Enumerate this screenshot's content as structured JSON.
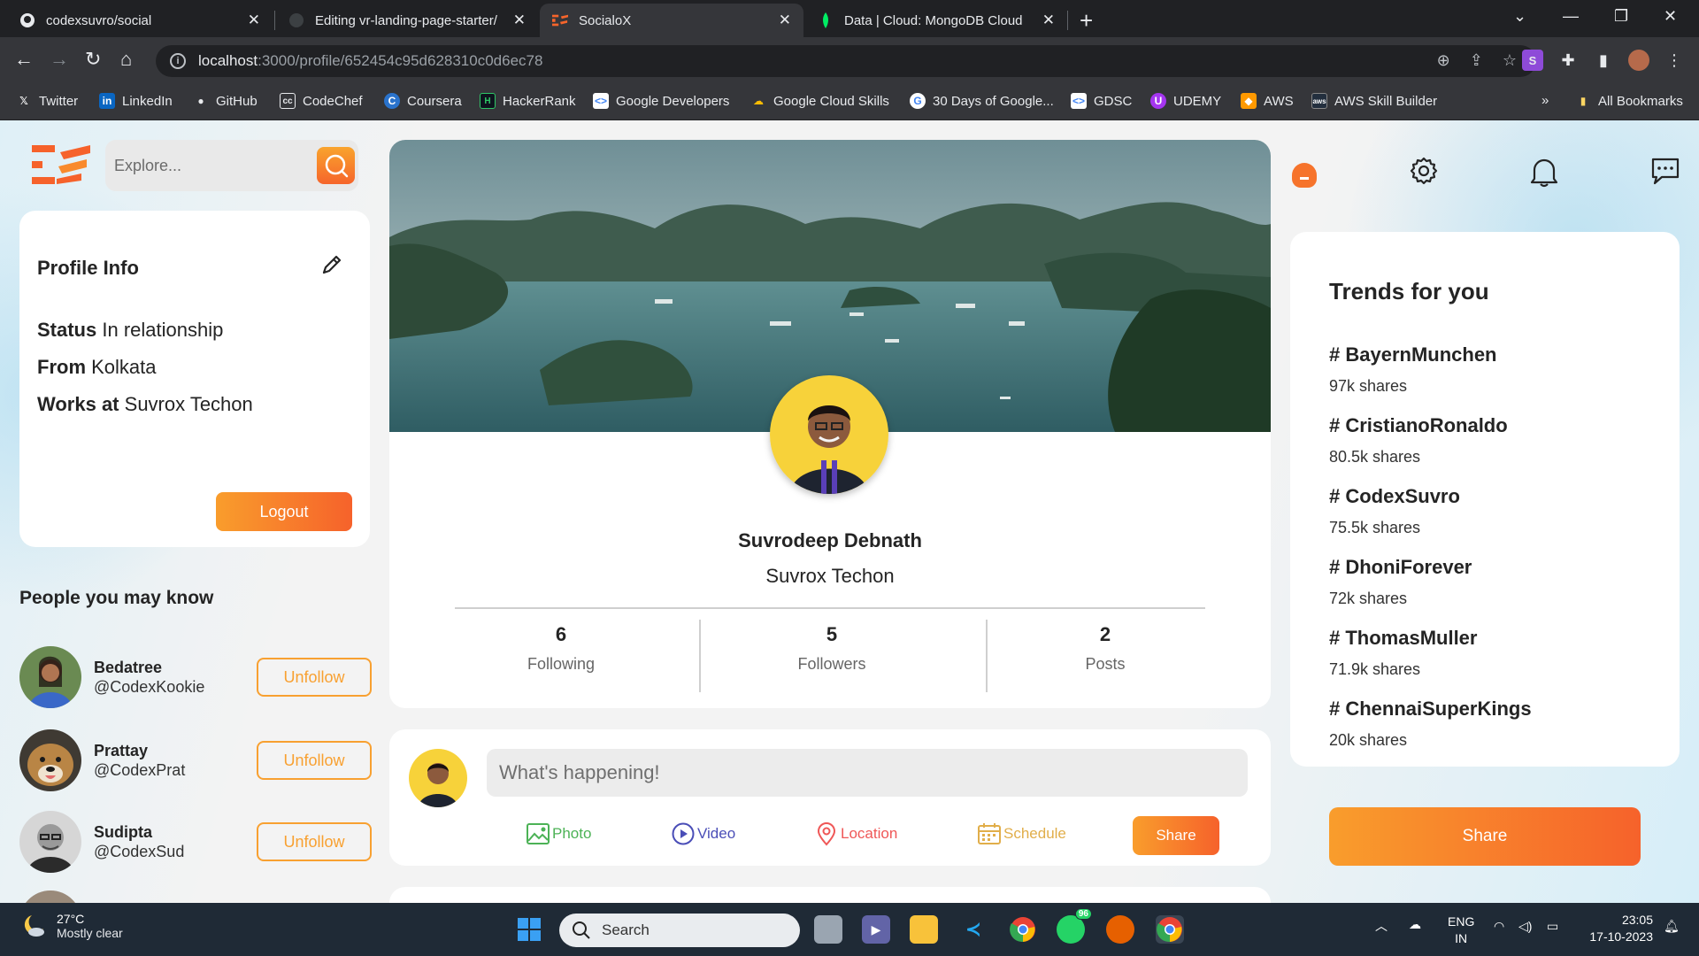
{
  "browser": {
    "tabs": [
      {
        "title": "codexsuvro/social",
        "active": false
      },
      {
        "title": "Editing vr-landing-page-starter/",
        "active": false
      },
      {
        "title": "SocialoX",
        "active": true
      },
      {
        "title": "Data | Cloud: MongoDB Cloud",
        "active": false
      }
    ],
    "url_host": "localhost",
    "url_path": ":3000/profile/652454c95d628310c0d6ec78",
    "bookmarks": [
      {
        "label": "Twitter",
        "icon": "x-icon"
      },
      {
        "label": "LinkedIn",
        "icon": "linkedin-icon"
      },
      {
        "label": "GitHub",
        "icon": "github-icon"
      },
      {
        "label": "CodeChef",
        "icon": "codechef-icon"
      },
      {
        "label": "Coursera",
        "icon": "coursera-icon"
      },
      {
        "label": "HackerRank",
        "icon": "hackerrank-icon"
      },
      {
        "label": "Google Developers",
        "icon": "google-developers-icon"
      },
      {
        "label": "Google Cloud Skills",
        "icon": "google-cloud-icon"
      },
      {
        "label": "30 Days of Google...",
        "icon": "google-icon"
      },
      {
        "label": "GDSC",
        "icon": "gdsc-icon"
      },
      {
        "label": "UDEMY",
        "icon": "udemy-icon"
      },
      {
        "label": "AWS",
        "icon": "aws-icon"
      },
      {
        "label": "AWS Skill Builder",
        "icon": "aws-icon"
      }
    ],
    "more_bookmarks": "»",
    "all_bookmarks": "All Bookmarks"
  },
  "app": {
    "search_placeholder": "Explore...",
    "profile_info": {
      "title": "Profile Info",
      "status_label": "Status",
      "status_value": "In relationship",
      "from_label": "From",
      "from_value": "Kolkata",
      "works_label": "Works at",
      "works_value": "Suvrox Techon",
      "logout": "Logout"
    },
    "people_title": "People you may know",
    "people": [
      {
        "name": "Bedatree",
        "handle": "@CodexKookie",
        "action": "Unfollow"
      },
      {
        "name": "Prattay",
        "handle": "@CodexPrat",
        "action": "Unfollow"
      },
      {
        "name": "Sudipta",
        "handle": "@CodexSud",
        "action": "Unfollow"
      }
    ],
    "profile": {
      "name": "Suvrodeep Debnath",
      "work": "Suvrox Techon",
      "stats": [
        {
          "value": "6",
          "label": "Following"
        },
        {
          "value": "5",
          "label": "Followers"
        },
        {
          "value": "2",
          "label": "Posts"
        }
      ]
    },
    "post_box": {
      "placeholder": "What's happening!",
      "options": [
        {
          "label": "Photo",
          "color": "#4cb256"
        },
        {
          "label": "Video",
          "color": "#4a4eb7"
        },
        {
          "label": "Location",
          "color": "#ef5757"
        },
        {
          "label": "Schedule",
          "color": "#e1ae4a"
        }
      ],
      "share": "Share"
    },
    "trends_title": "Trends for you",
    "trends": [
      {
        "tag": "# BayernMunchen",
        "shares": "97k shares"
      },
      {
        "tag": "# CristianoRonaldo",
        "shares": "80.5k shares"
      },
      {
        "tag": "# CodexSuvro",
        "shares": "75.5k shares"
      },
      {
        "tag": "# DhoniForever",
        "shares": "72k shares"
      },
      {
        "tag": "# ThomasMuller",
        "shares": "71.9k shares"
      },
      {
        "tag": "# ChennaiSuperKings",
        "shares": "20k shares"
      }
    ],
    "share_big": "Share",
    "accent": "#f99d2c"
  },
  "taskbar": {
    "temp": "27°C",
    "weather": "Mostly clear",
    "search": "Search",
    "whatsapp_badge": "96",
    "lang1": "ENG",
    "lang2": "IN",
    "time": "23:05",
    "date": "17-10-2023"
  }
}
